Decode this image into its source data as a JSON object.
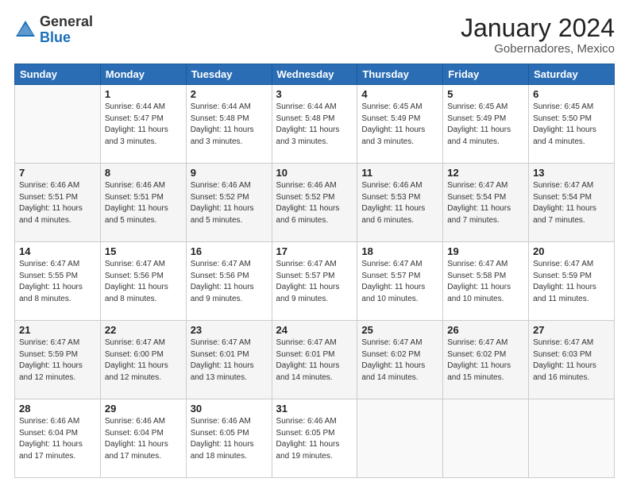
{
  "logo": {
    "general": "General",
    "blue": "Blue"
  },
  "header": {
    "title": "January 2024",
    "subtitle": "Gobernadores, Mexico"
  },
  "weekdays": [
    "Sunday",
    "Monday",
    "Tuesday",
    "Wednesday",
    "Thursday",
    "Friday",
    "Saturday"
  ],
  "weeks": [
    [
      {
        "day": null
      },
      {
        "day": "1",
        "sunrise": "Sunrise: 6:44 AM",
        "sunset": "Sunset: 5:47 PM",
        "daylight": "Daylight: 11 hours and 3 minutes."
      },
      {
        "day": "2",
        "sunrise": "Sunrise: 6:44 AM",
        "sunset": "Sunset: 5:48 PM",
        "daylight": "Daylight: 11 hours and 3 minutes."
      },
      {
        "day": "3",
        "sunrise": "Sunrise: 6:44 AM",
        "sunset": "Sunset: 5:48 PM",
        "daylight": "Daylight: 11 hours and 3 minutes."
      },
      {
        "day": "4",
        "sunrise": "Sunrise: 6:45 AM",
        "sunset": "Sunset: 5:49 PM",
        "daylight": "Daylight: 11 hours and 3 minutes."
      },
      {
        "day": "5",
        "sunrise": "Sunrise: 6:45 AM",
        "sunset": "Sunset: 5:49 PM",
        "daylight": "Daylight: 11 hours and 4 minutes."
      },
      {
        "day": "6",
        "sunrise": "Sunrise: 6:45 AM",
        "sunset": "Sunset: 5:50 PM",
        "daylight": "Daylight: 11 hours and 4 minutes."
      }
    ],
    [
      {
        "day": "7",
        "sunrise": "Sunrise: 6:46 AM",
        "sunset": "Sunset: 5:51 PM",
        "daylight": "Daylight: 11 hours and 4 minutes."
      },
      {
        "day": "8",
        "sunrise": "Sunrise: 6:46 AM",
        "sunset": "Sunset: 5:51 PM",
        "daylight": "Daylight: 11 hours and 5 minutes."
      },
      {
        "day": "9",
        "sunrise": "Sunrise: 6:46 AM",
        "sunset": "Sunset: 5:52 PM",
        "daylight": "Daylight: 11 hours and 5 minutes."
      },
      {
        "day": "10",
        "sunrise": "Sunrise: 6:46 AM",
        "sunset": "Sunset: 5:52 PM",
        "daylight": "Daylight: 11 hours and 6 minutes."
      },
      {
        "day": "11",
        "sunrise": "Sunrise: 6:46 AM",
        "sunset": "Sunset: 5:53 PM",
        "daylight": "Daylight: 11 hours and 6 minutes."
      },
      {
        "day": "12",
        "sunrise": "Sunrise: 6:47 AM",
        "sunset": "Sunset: 5:54 PM",
        "daylight": "Daylight: 11 hours and 7 minutes."
      },
      {
        "day": "13",
        "sunrise": "Sunrise: 6:47 AM",
        "sunset": "Sunset: 5:54 PM",
        "daylight": "Daylight: 11 hours and 7 minutes."
      }
    ],
    [
      {
        "day": "14",
        "sunrise": "Sunrise: 6:47 AM",
        "sunset": "Sunset: 5:55 PM",
        "daylight": "Daylight: 11 hours and 8 minutes."
      },
      {
        "day": "15",
        "sunrise": "Sunrise: 6:47 AM",
        "sunset": "Sunset: 5:56 PM",
        "daylight": "Daylight: 11 hours and 8 minutes."
      },
      {
        "day": "16",
        "sunrise": "Sunrise: 6:47 AM",
        "sunset": "Sunset: 5:56 PM",
        "daylight": "Daylight: 11 hours and 9 minutes."
      },
      {
        "day": "17",
        "sunrise": "Sunrise: 6:47 AM",
        "sunset": "Sunset: 5:57 PM",
        "daylight": "Daylight: 11 hours and 9 minutes."
      },
      {
        "day": "18",
        "sunrise": "Sunrise: 6:47 AM",
        "sunset": "Sunset: 5:57 PM",
        "daylight": "Daylight: 11 hours and 10 minutes."
      },
      {
        "day": "19",
        "sunrise": "Sunrise: 6:47 AM",
        "sunset": "Sunset: 5:58 PM",
        "daylight": "Daylight: 11 hours and 10 minutes."
      },
      {
        "day": "20",
        "sunrise": "Sunrise: 6:47 AM",
        "sunset": "Sunset: 5:59 PM",
        "daylight": "Daylight: 11 hours and 11 minutes."
      }
    ],
    [
      {
        "day": "21",
        "sunrise": "Sunrise: 6:47 AM",
        "sunset": "Sunset: 5:59 PM",
        "daylight": "Daylight: 11 hours and 12 minutes."
      },
      {
        "day": "22",
        "sunrise": "Sunrise: 6:47 AM",
        "sunset": "Sunset: 6:00 PM",
        "daylight": "Daylight: 11 hours and 12 minutes."
      },
      {
        "day": "23",
        "sunrise": "Sunrise: 6:47 AM",
        "sunset": "Sunset: 6:01 PM",
        "daylight": "Daylight: 11 hours and 13 minutes."
      },
      {
        "day": "24",
        "sunrise": "Sunrise: 6:47 AM",
        "sunset": "Sunset: 6:01 PM",
        "daylight": "Daylight: 11 hours and 14 minutes."
      },
      {
        "day": "25",
        "sunrise": "Sunrise: 6:47 AM",
        "sunset": "Sunset: 6:02 PM",
        "daylight": "Daylight: 11 hours and 14 minutes."
      },
      {
        "day": "26",
        "sunrise": "Sunrise: 6:47 AM",
        "sunset": "Sunset: 6:02 PM",
        "daylight": "Daylight: 11 hours and 15 minutes."
      },
      {
        "day": "27",
        "sunrise": "Sunrise: 6:47 AM",
        "sunset": "Sunset: 6:03 PM",
        "daylight": "Daylight: 11 hours and 16 minutes."
      }
    ],
    [
      {
        "day": "28",
        "sunrise": "Sunrise: 6:46 AM",
        "sunset": "Sunset: 6:04 PM",
        "daylight": "Daylight: 11 hours and 17 minutes."
      },
      {
        "day": "29",
        "sunrise": "Sunrise: 6:46 AM",
        "sunset": "Sunset: 6:04 PM",
        "daylight": "Daylight: 11 hours and 17 minutes."
      },
      {
        "day": "30",
        "sunrise": "Sunrise: 6:46 AM",
        "sunset": "Sunset: 6:05 PM",
        "daylight": "Daylight: 11 hours and 18 minutes."
      },
      {
        "day": "31",
        "sunrise": "Sunrise: 6:46 AM",
        "sunset": "Sunset: 6:05 PM",
        "daylight": "Daylight: 11 hours and 19 minutes."
      },
      {
        "day": null
      },
      {
        "day": null
      },
      {
        "day": null
      }
    ]
  ]
}
